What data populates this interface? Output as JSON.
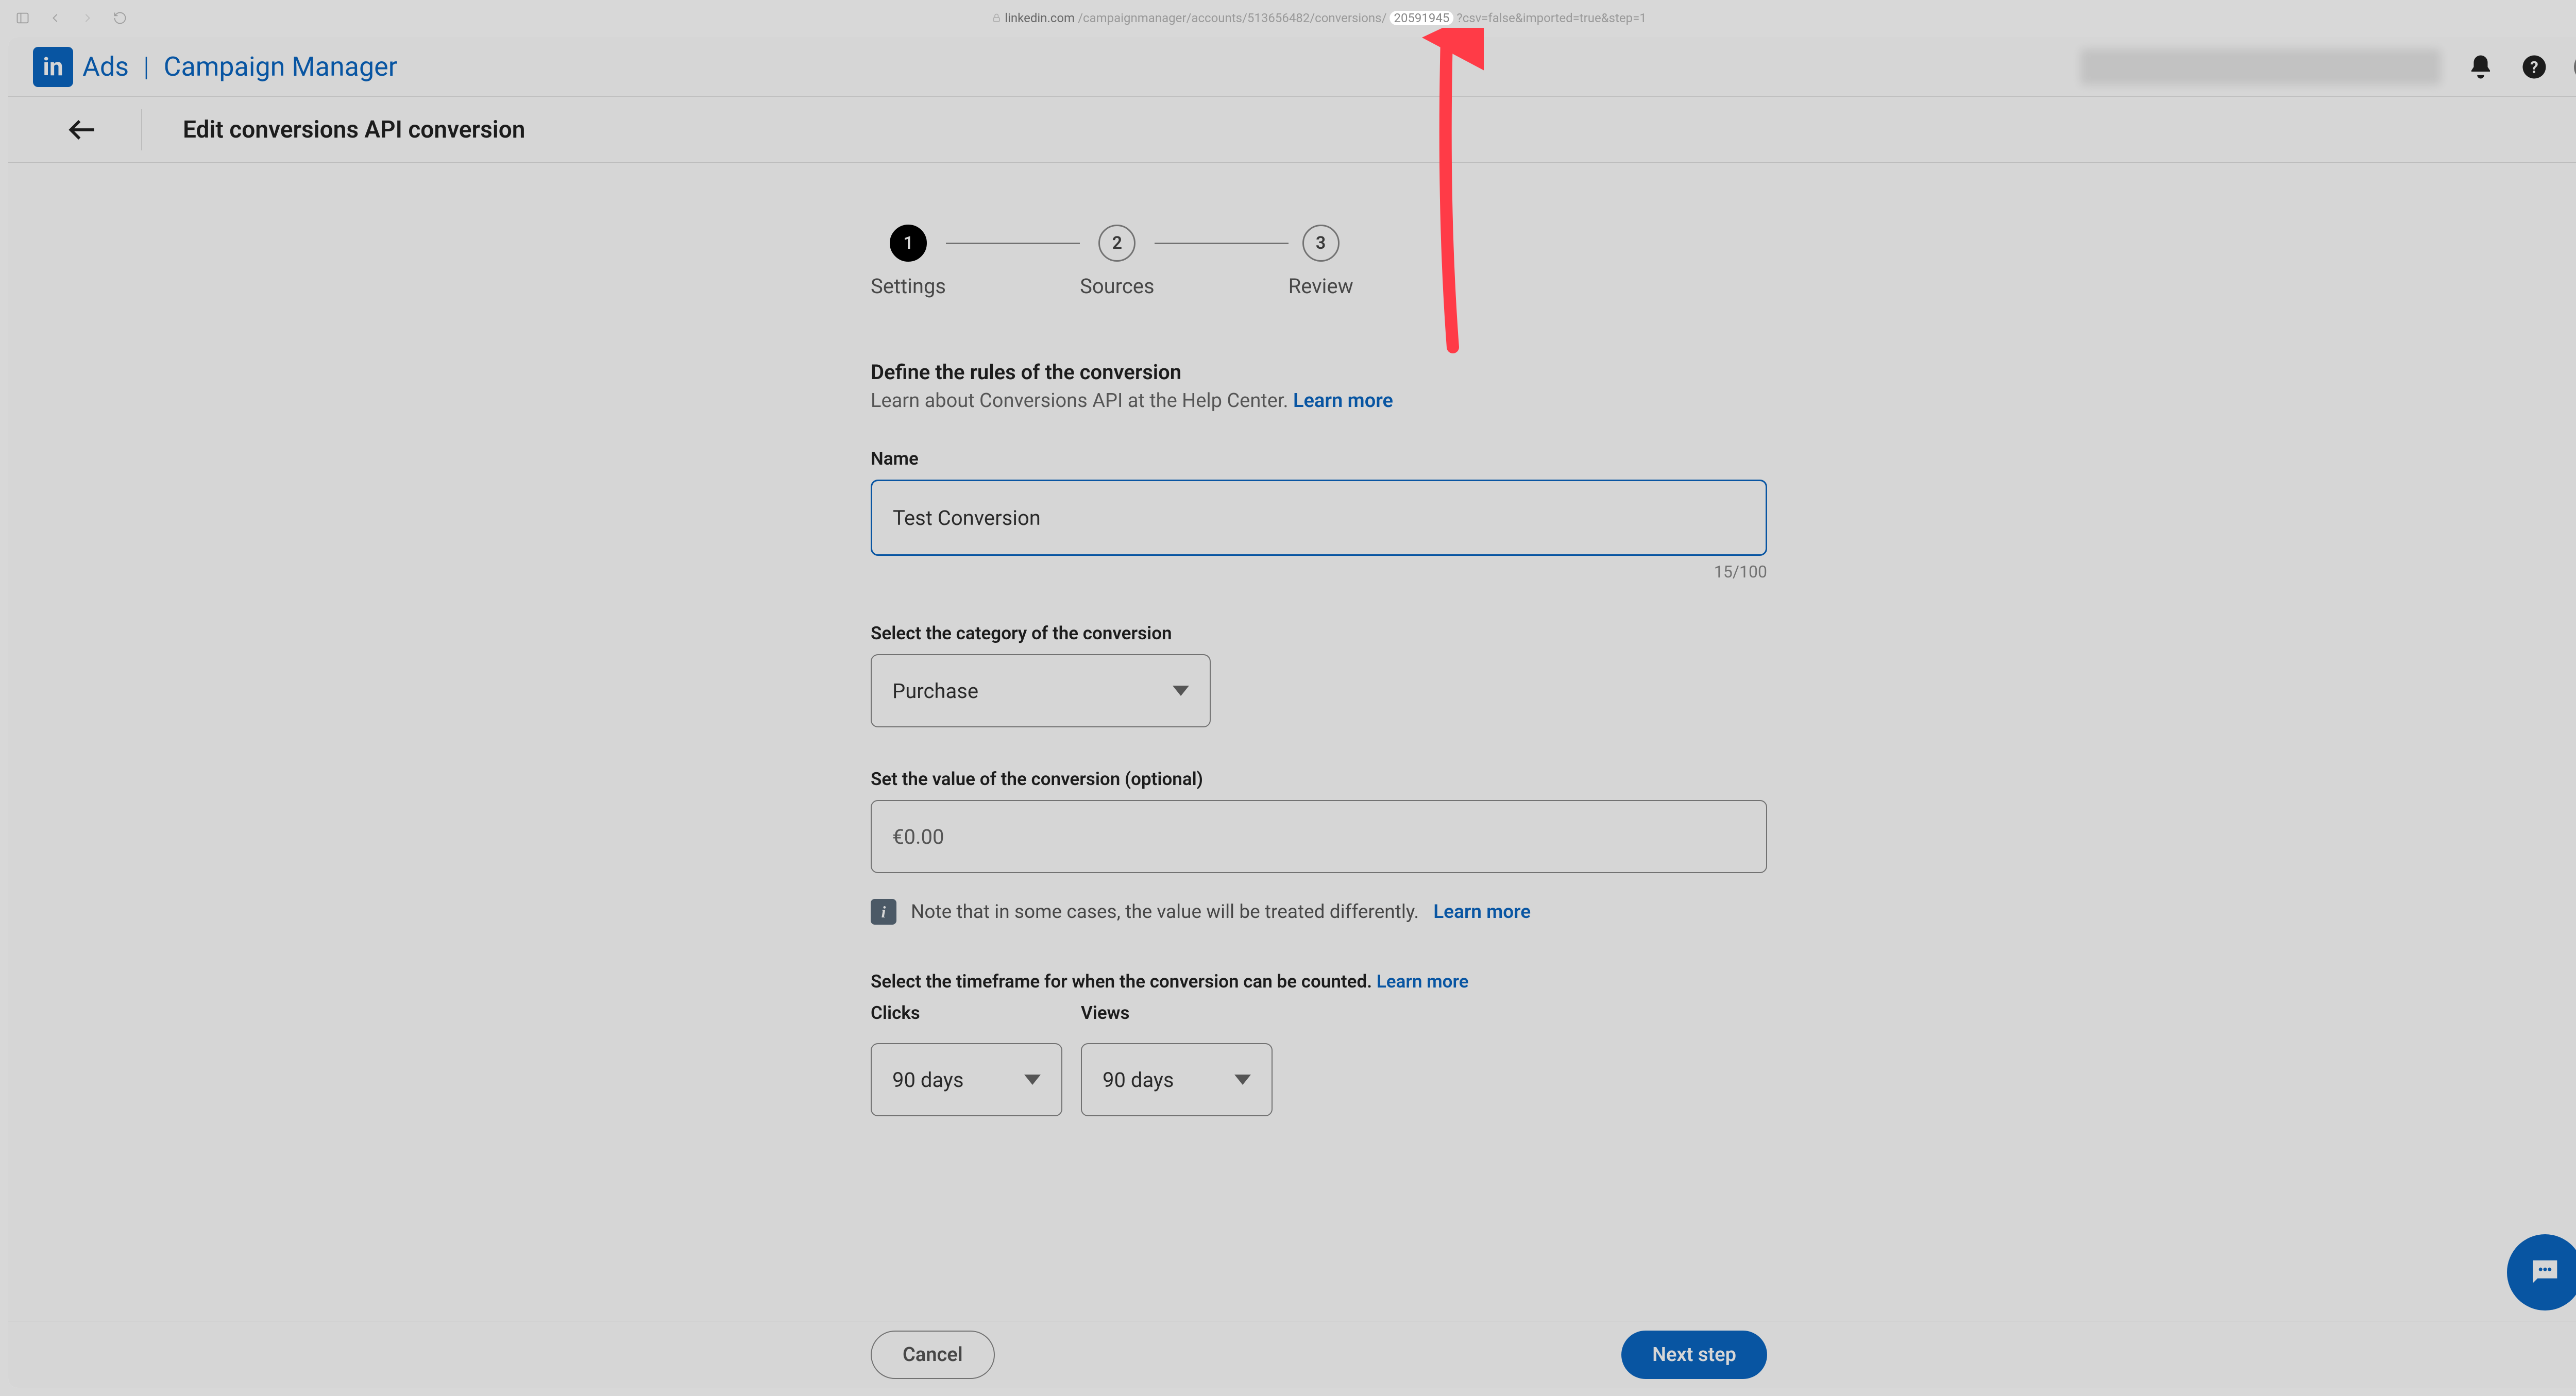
{
  "browser": {
    "url_domain": "linkedin.com",
    "url_path_before": "/campaignmanager/accounts/513656482/conversions/",
    "url_highlight": "20591945",
    "url_path_after": "?csv=false&imported=true&step=1"
  },
  "header": {
    "logo_in": "in",
    "logo_ads": "Ads",
    "logo_divider": "|",
    "logo_cm": "Campaign Manager"
  },
  "page": {
    "title": "Edit conversions API conversion"
  },
  "stepper": {
    "steps": [
      {
        "num": "1",
        "label": "Settings"
      },
      {
        "num": "2",
        "label": "Sources"
      },
      {
        "num": "3",
        "label": "Review"
      }
    ]
  },
  "section": {
    "title": "Define the rules of the conversion",
    "sub": "Learn about Conversions API at the Help Center. ",
    "learn_more": "Learn more"
  },
  "name_field": {
    "label": "Name",
    "value": "Test Conversion",
    "counter": "15/100"
  },
  "category": {
    "label": "Select the category of the conversion",
    "value": "Purchase"
  },
  "value_field": {
    "label": "Set the value of the conversion (optional)",
    "value": "€0.00"
  },
  "note": {
    "text": "Note that in some cases, the value will be treated differently. ",
    "learn_more": "Learn more"
  },
  "timeframe": {
    "label": "Select the timeframe for when the conversion can be counted. ",
    "learn_more": "Learn more",
    "clicks_label": "Clicks",
    "clicks_value": "90 days",
    "views_label": "Views",
    "views_value": "90 days"
  },
  "footer": {
    "cancel": "Cancel",
    "next": "Next step"
  }
}
